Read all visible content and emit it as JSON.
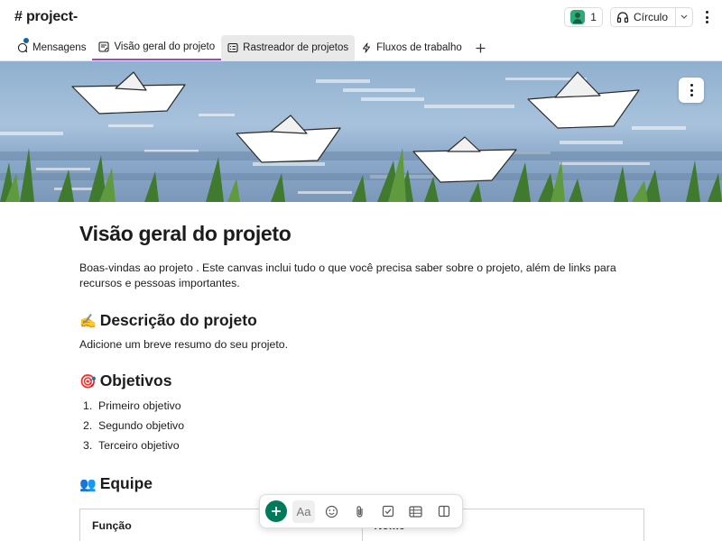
{
  "header": {
    "channel_title": "# project-",
    "member_count": "1",
    "huddle_label": "Círculo"
  },
  "tabs": [
    {
      "label": "Mensagens",
      "icon": "message-icon",
      "active": false
    },
    {
      "label": "Visão geral do projeto",
      "icon": "canvas-icon",
      "active": true
    },
    {
      "label": "Rastreador de projetos",
      "icon": "list-icon",
      "active": false
    },
    {
      "label": "Fluxos de trabalho",
      "icon": "workflow-icon",
      "active": false
    }
  ],
  "colors": {
    "active_tab_underline": "#9b4fa6",
    "add_button": "#007a5a",
    "notification_dot": "#1264a3"
  },
  "canvas": {
    "title": "Visão geral do projeto",
    "intro": "Boas-vindas ao projeto . Este canvas inclui tudo o que você precisa saber sobre o projeto, além de links para recursos e pessoas importantes.",
    "description_heading": "Descrição do projeto",
    "description_emoji": "✍️",
    "description_text": "Adicione um breve resumo do seu projeto.",
    "objectives_heading": "Objetivos",
    "objectives_emoji": "🎯",
    "objectives": [
      "Primeiro objetivo",
      "Segundo objetivo",
      "Terceiro objetivo"
    ],
    "team_heading": "Equipe",
    "team_emoji": "👥",
    "team_columns": [
      "Função",
      "Nome"
    ]
  },
  "toolbar": {
    "text_format_label": "Aa",
    "items": [
      "add-icon",
      "text-format-icon",
      "emoji-icon",
      "attachment-icon",
      "checklist-icon",
      "table-icon",
      "columns-icon"
    ]
  }
}
